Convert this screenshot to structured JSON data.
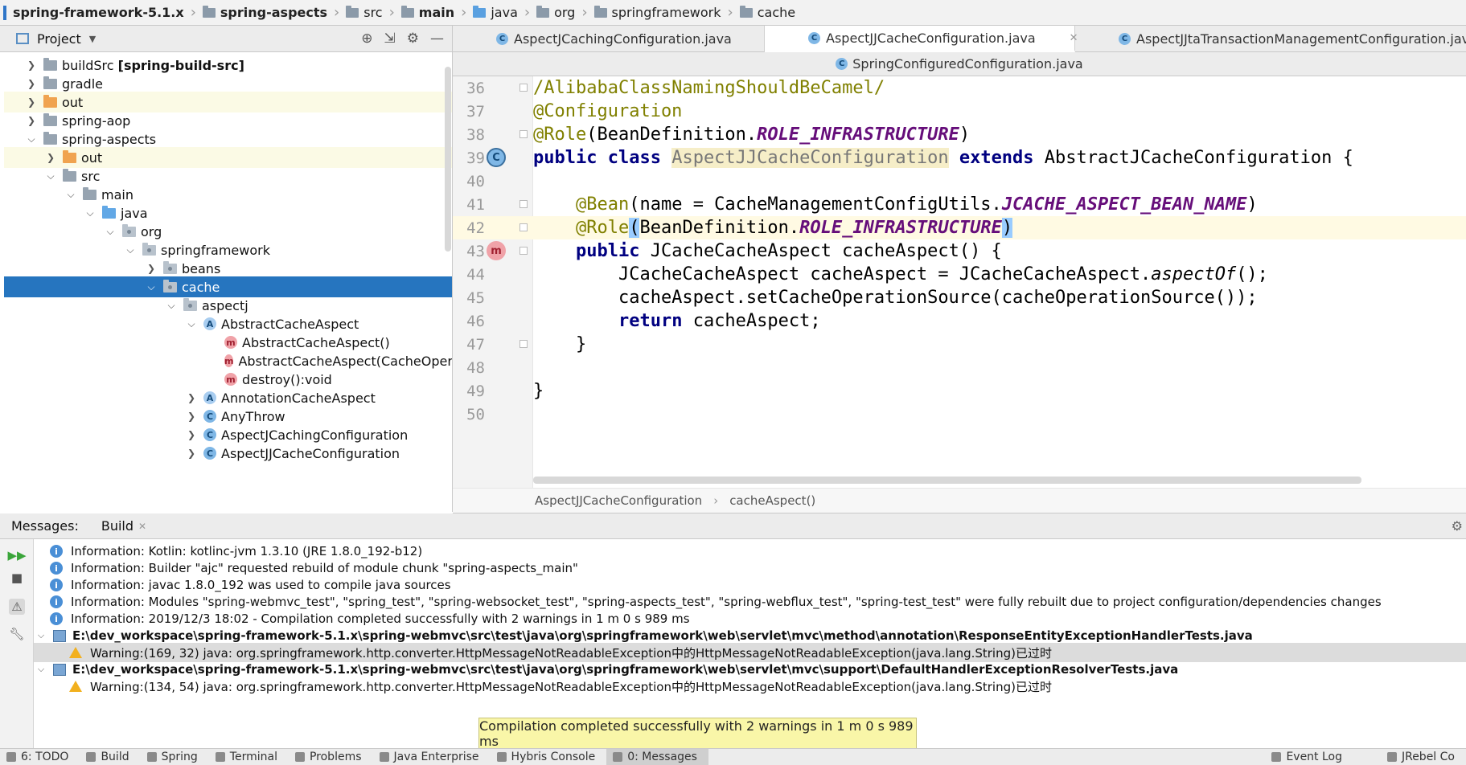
{
  "breadcrumb": [
    {
      "label": "spring-framework-5.1.x",
      "bold": true
    },
    {
      "label": "spring-aspects",
      "bold": true
    },
    {
      "label": "src",
      "bold": false
    },
    {
      "label": "main",
      "bold": true
    },
    {
      "label": "java",
      "bold": false
    },
    {
      "label": "org",
      "bold": false
    },
    {
      "label": "springframework",
      "bold": false
    },
    {
      "label": "cache",
      "bold": false
    }
  ],
  "project_panel": {
    "title": "Project",
    "tree": [
      {
        "label": "buildSrc",
        "suffix": "[spring-build-src]",
        "icon": "folder-icon"
      },
      {
        "label": "gradle",
        "icon": "folder-icon"
      },
      {
        "label": "out",
        "icon": "folder-orange-icon"
      },
      {
        "label": "spring-aop",
        "icon": "folder-icon"
      },
      {
        "label": "spring-aspects",
        "icon": "folder-icon"
      },
      {
        "label": "out",
        "icon": "folder-orange-icon"
      },
      {
        "label": "src",
        "icon": "folder-icon"
      },
      {
        "label": "main",
        "icon": "folder-icon"
      },
      {
        "label": "java",
        "icon": "folder-blue-icon"
      },
      {
        "label": "org",
        "icon": "package-icon"
      },
      {
        "label": "springframework",
        "icon": "package-icon"
      },
      {
        "label": "beans",
        "icon": "package-icon"
      },
      {
        "label": "cache",
        "icon": "package-icon"
      },
      {
        "label": "aspectj",
        "icon": "package-icon"
      },
      {
        "label": "AbstractCacheAspect",
        "icon": "abstract-class-icon"
      },
      {
        "label": "AbstractCacheAspect()",
        "icon": "method-icon"
      },
      {
        "label": "AbstractCacheAspect(CacheOperat",
        "icon": "method-icon"
      },
      {
        "label": "destroy():void",
        "icon": "method-icon"
      },
      {
        "label": "AnnotationCacheAspect",
        "icon": "abstract-class-icon"
      },
      {
        "label": "AnyThrow",
        "icon": "class-icon"
      },
      {
        "label": "AspectJCachingConfiguration",
        "icon": "class-icon"
      },
      {
        "label": "AspectJJCacheConfiguration",
        "icon": "class-icon"
      }
    ]
  },
  "tabs": [
    {
      "label": "AspectJCachingConfiguration.java",
      "active": false
    },
    {
      "label": "AspectJJCacheConfiguration.java",
      "active": true
    },
    {
      "label": "AspectJJtaTransactionManagementConfiguration.java",
      "active": false
    }
  ],
  "tabs_row2": [
    {
      "label": "SpringConfiguredConfiguration.java"
    }
  ],
  "editor": {
    "line_numbers": [
      "36",
      "37",
      "38",
      "39",
      "40",
      "41",
      "42",
      "43",
      "44",
      "45",
      "46",
      "47",
      "48",
      "49",
      "50"
    ],
    "current_line": "42"
  },
  "code_breadcrumb": [
    "AspectJJCacheConfiguration",
    "cacheAspect()"
  ],
  "messages_panel": {
    "title": "Messages:",
    "tab": "Build",
    "rows": [
      "Information: Kotlin: kotlinc-jvm 1.3.10 (JRE 1.8.0_192-b12)",
      "Information: Builder \"ajc\" requested rebuild of module chunk \"spring-aspects_main\"",
      "Information: javac 1.8.0_192 was used to compile java sources",
      "Information: Modules \"spring-webmvc_test\", \"spring_test\", \"spring-websocket_test\", \"spring-aspects_test\", \"spring-webflux_test\", \"spring-test_test\" were fully rebuilt due to project configuration/dependencies changes",
      "Information: 2019/12/3 18:02 - Compilation completed successfully with 2 warnings in 1 m 0 s 989 ms",
      "E:\\dev_workspace\\spring-framework-5.1.x\\spring-webmvc\\src\\test\\java\\org\\springframework\\web\\servlet\\mvc\\method\\annotation\\ResponseEntityExceptionHandlerTests.java",
      "Warning:(169, 32)  java: org.springframework.http.converter.HttpMessageNotReadableException中的HttpMessageNotReadableException(java.lang.String)已过时",
      "E:\\dev_workspace\\spring-framework-5.1.x\\spring-webmvc\\src\\test\\java\\org\\springframework\\web\\servlet\\mvc\\support\\DefaultHandlerExceptionResolverTests.java",
      "Warning:(134, 54)  java: org.springframework.http.converter.HttpMessageNotReadableException中的HttpMessageNotReadableException(java.lang.String)已过时"
    ]
  },
  "tooltip": "Compilation completed successfully with 2 warnings in 1 m 0 s 989 ms",
  "tool_windows": [
    "6: TODO",
    "Build",
    "Spring",
    "Terminal",
    "Problems",
    "Java Enterprise",
    "Hybris Console",
    "0: Messages",
    "Event Log",
    "JRebel Co"
  ]
}
